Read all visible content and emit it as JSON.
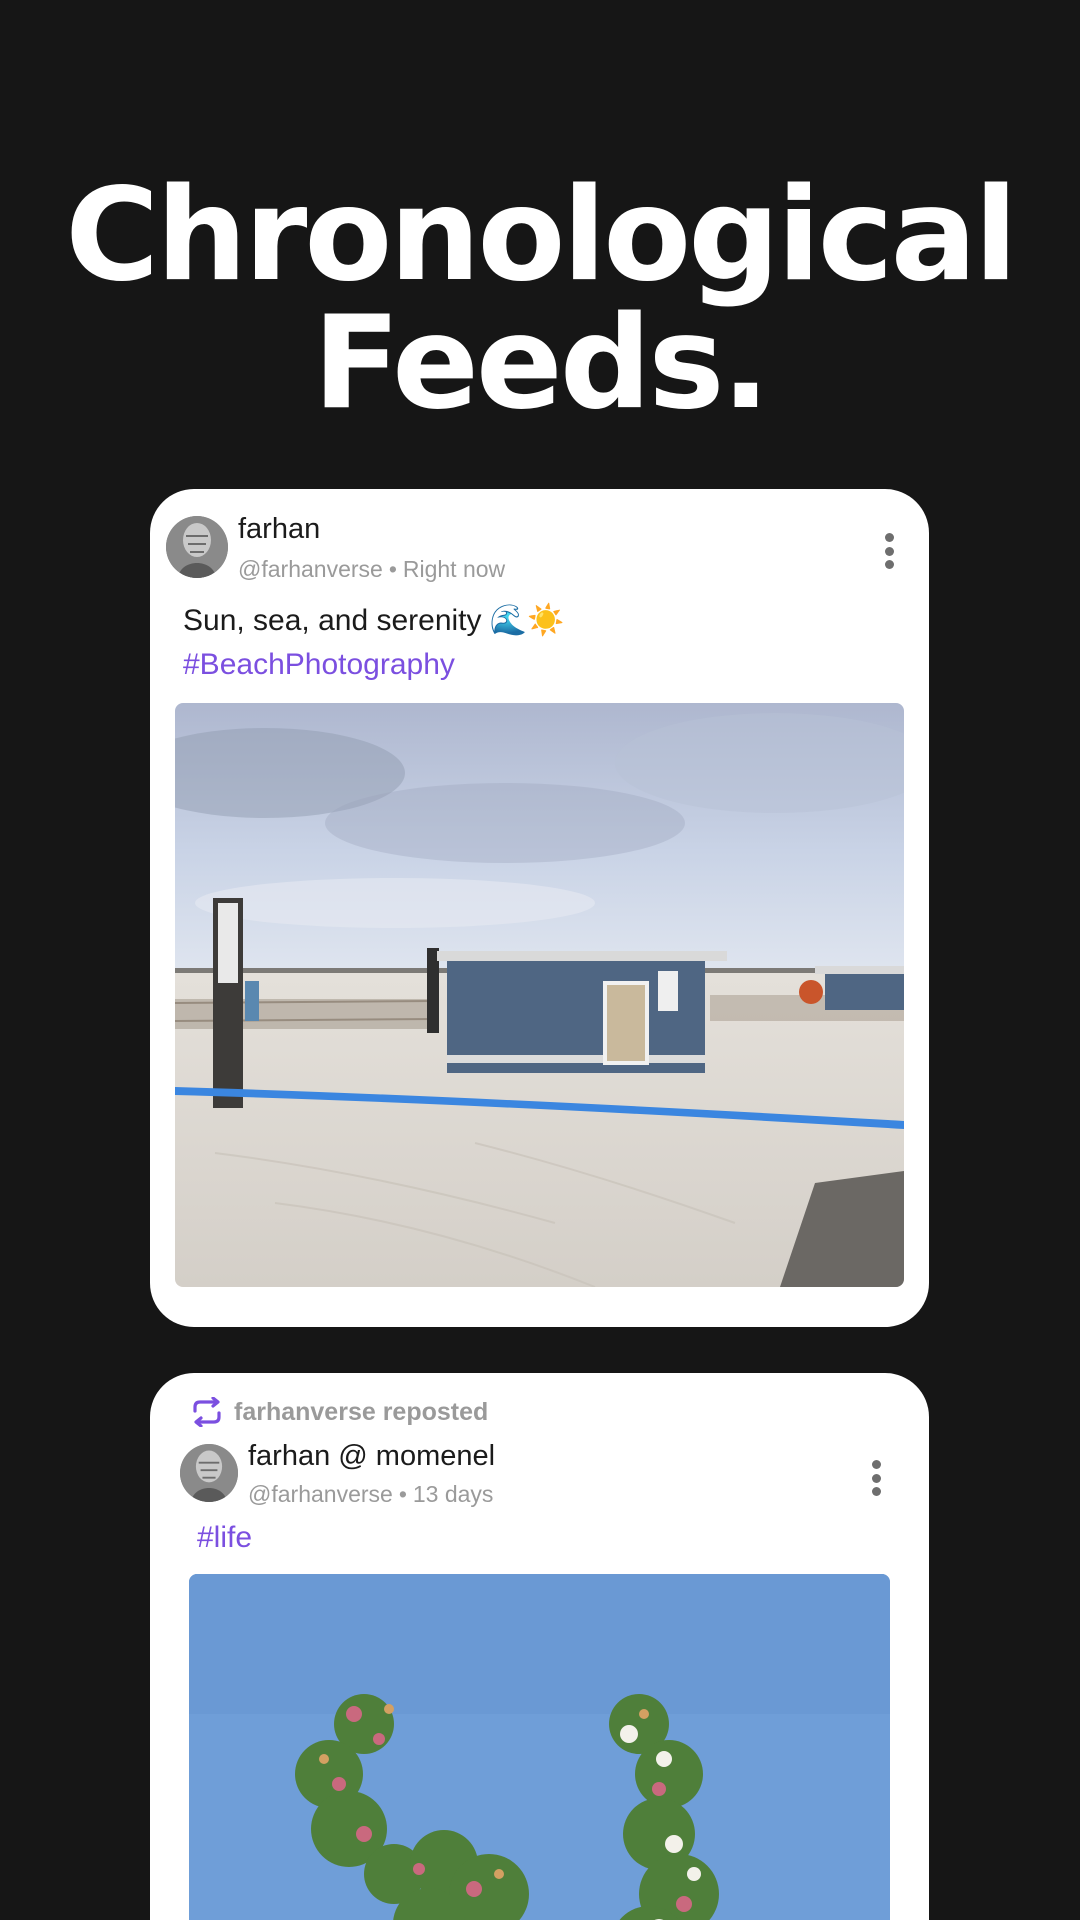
{
  "headline": {
    "line1": "Chronological",
    "line2": "Feeds."
  },
  "posts": [
    {
      "display_name": "farhan",
      "handle": "@farhanverse",
      "separator": "•",
      "time": "Right now",
      "text": "Sun, sea, and serenity 🌊☀️",
      "hashtag": "#BeachPhotography",
      "menu_icon": "more-vertical-icon"
    },
    {
      "repost_label": "farhanverse reposted",
      "repost_icon": "repost-icon",
      "display_name": "farhan @ momenel",
      "handle": "@farhanverse",
      "separator": "•",
      "time": "13 days",
      "hashtag": "#life",
      "menu_icon": "more-vertical-icon"
    }
  ],
  "colors": {
    "background": "#161616",
    "card": "#ffffff",
    "hashtag": "#7b4fe0",
    "muted": "#9a9a9a"
  }
}
